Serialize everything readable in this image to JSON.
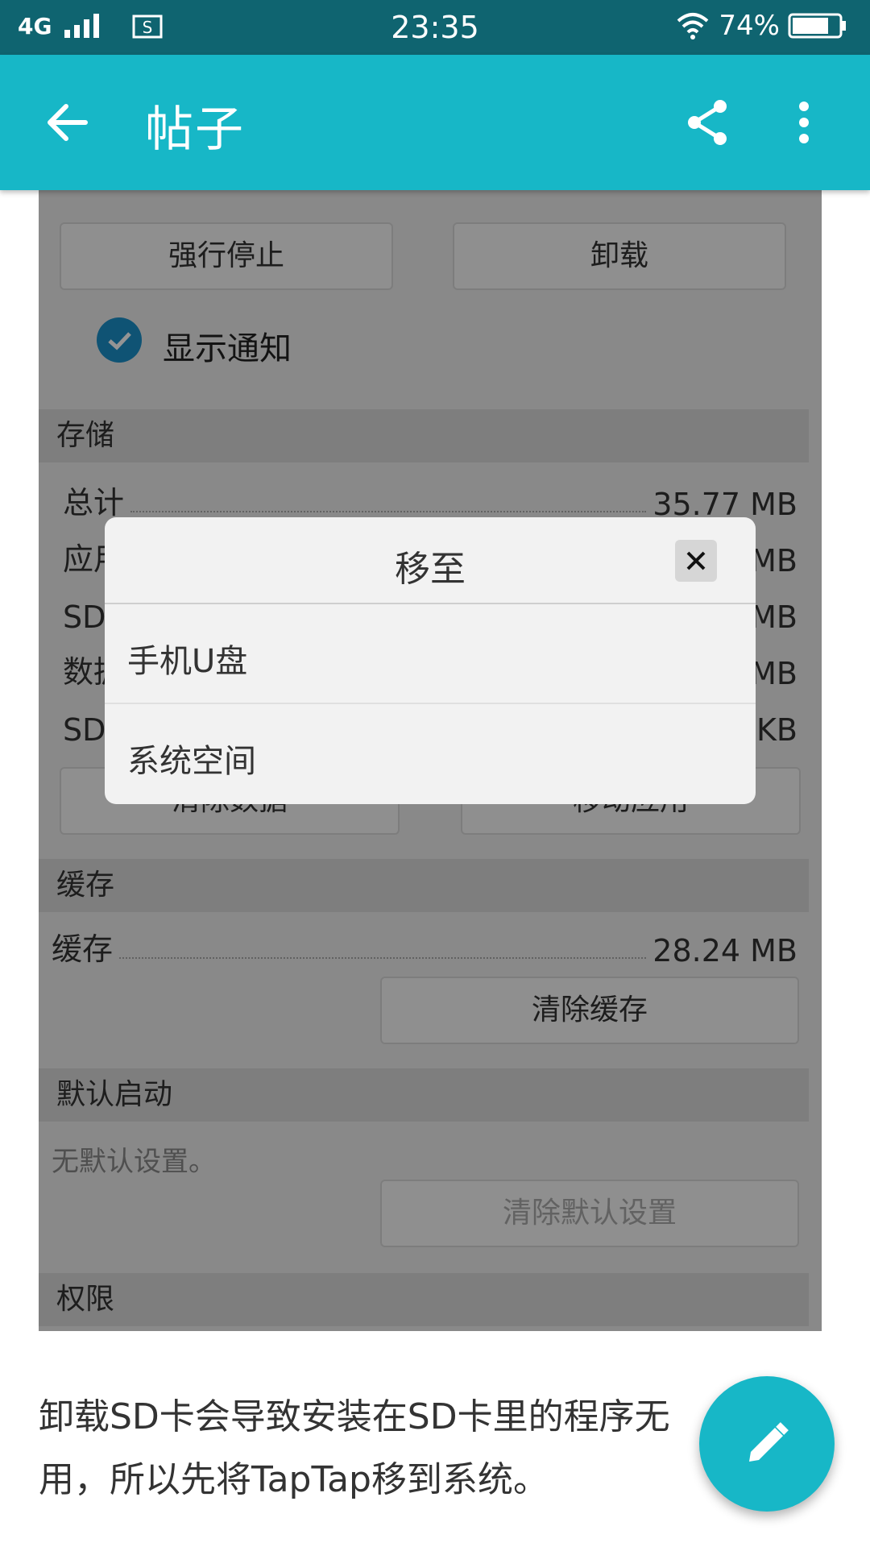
{
  "status_bar": {
    "network": "4G",
    "time": "23:35",
    "battery": "74%"
  },
  "app_bar": {
    "title": "帖子"
  },
  "screenshot": {
    "buttons": {
      "force_stop": "强行停止",
      "uninstall": "卸载",
      "clear_data": "清除数据",
      "move_app": "移动应用",
      "clear_cache": "清除缓存",
      "clear_defaults": "清除默认设置"
    },
    "show_notifications": "显示通知",
    "storage": {
      "header": "存储",
      "rows": [
        {
          "label": "总计",
          "value": "35.77 MB"
        },
        {
          "label": "应用",
          "value": "MB"
        },
        {
          "label": "SD",
          "value": "MB"
        },
        {
          "label": "数据",
          "value": "MB"
        },
        {
          "label": "SD",
          "value": "KB"
        }
      ]
    },
    "cache": {
      "header": "缓存",
      "label": "缓存",
      "value": "28.24 MB"
    },
    "default_launch": {
      "header": "默认启动",
      "note": "无默认设置。"
    },
    "permissions_header": "权限"
  },
  "dialog": {
    "title": "移至",
    "options": [
      "手机U盘",
      "系统空间"
    ]
  },
  "post": {
    "text": "卸载SD卡会导致安装在SD卡里的程序无用，所以先将TapTap移到系统。"
  }
}
